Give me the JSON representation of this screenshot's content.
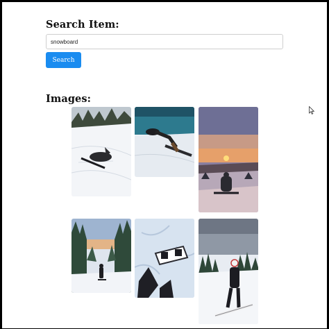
{
  "search": {
    "heading": "Search Item:",
    "input_value": "snowboard",
    "button_label": "Search"
  },
  "images": {
    "heading": "Images:"
  },
  "colors": {
    "button_bg": "#1a8cf0",
    "button_text": "#ffffff",
    "heading_text": "#111111"
  }
}
